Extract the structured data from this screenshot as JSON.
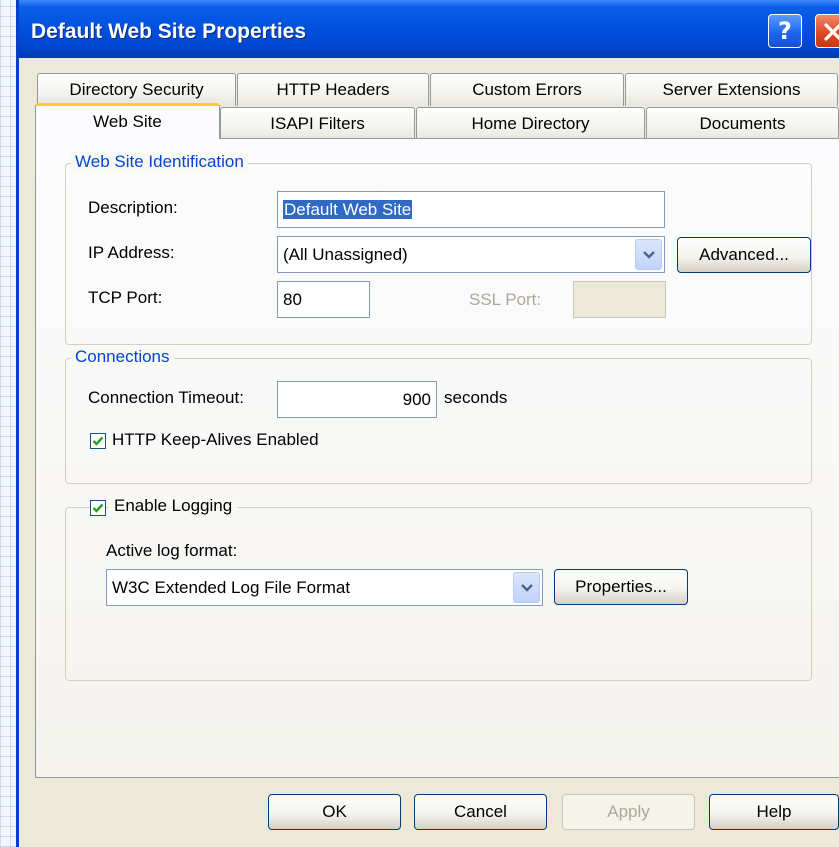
{
  "window": {
    "title": "Default Web Site Properties"
  },
  "tabs_back_row": [
    "Directory Security",
    "HTTP Headers",
    "Custom Errors",
    "Server Extensions"
  ],
  "tabs_front_row": [
    "Web Site",
    "ISAPI Filters",
    "Home Directory",
    "Documents"
  ],
  "identification": {
    "legend": "Web Site Identification",
    "description_label": "Description:",
    "description_value": "Default Web Site",
    "ip_label": "IP Address:",
    "ip_value": "(All Unassigned)",
    "advanced_label": "Advanced...",
    "tcp_label": "TCP Port:",
    "tcp_value": "80",
    "ssl_label": "SSL Port:",
    "ssl_value": ""
  },
  "connections": {
    "legend": "Connections",
    "timeout_label": "Connection Timeout:",
    "timeout_value": "900",
    "timeout_unit": "seconds",
    "keepalive_label": "HTTP Keep-Alives Enabled",
    "keepalive_checked": true
  },
  "logging": {
    "enable_label": "Enable Logging",
    "enable_checked": true,
    "format_label": "Active log format:",
    "format_value": "W3C Extended Log File Format",
    "properties_label": "Properties..."
  },
  "buttons": {
    "ok": "OK",
    "cancel": "Cancel",
    "apply": "Apply",
    "help": "Help"
  },
  "icons": {
    "help": "help-icon",
    "close": "close-icon",
    "dropdown": "chevron-down-icon",
    "check": "checkmark-icon"
  },
  "colors": {
    "titlebar": "#0052df",
    "legend_text": "#0046d5",
    "active_tab_accent": "#ffc83c",
    "close_button": "#de4a23"
  }
}
